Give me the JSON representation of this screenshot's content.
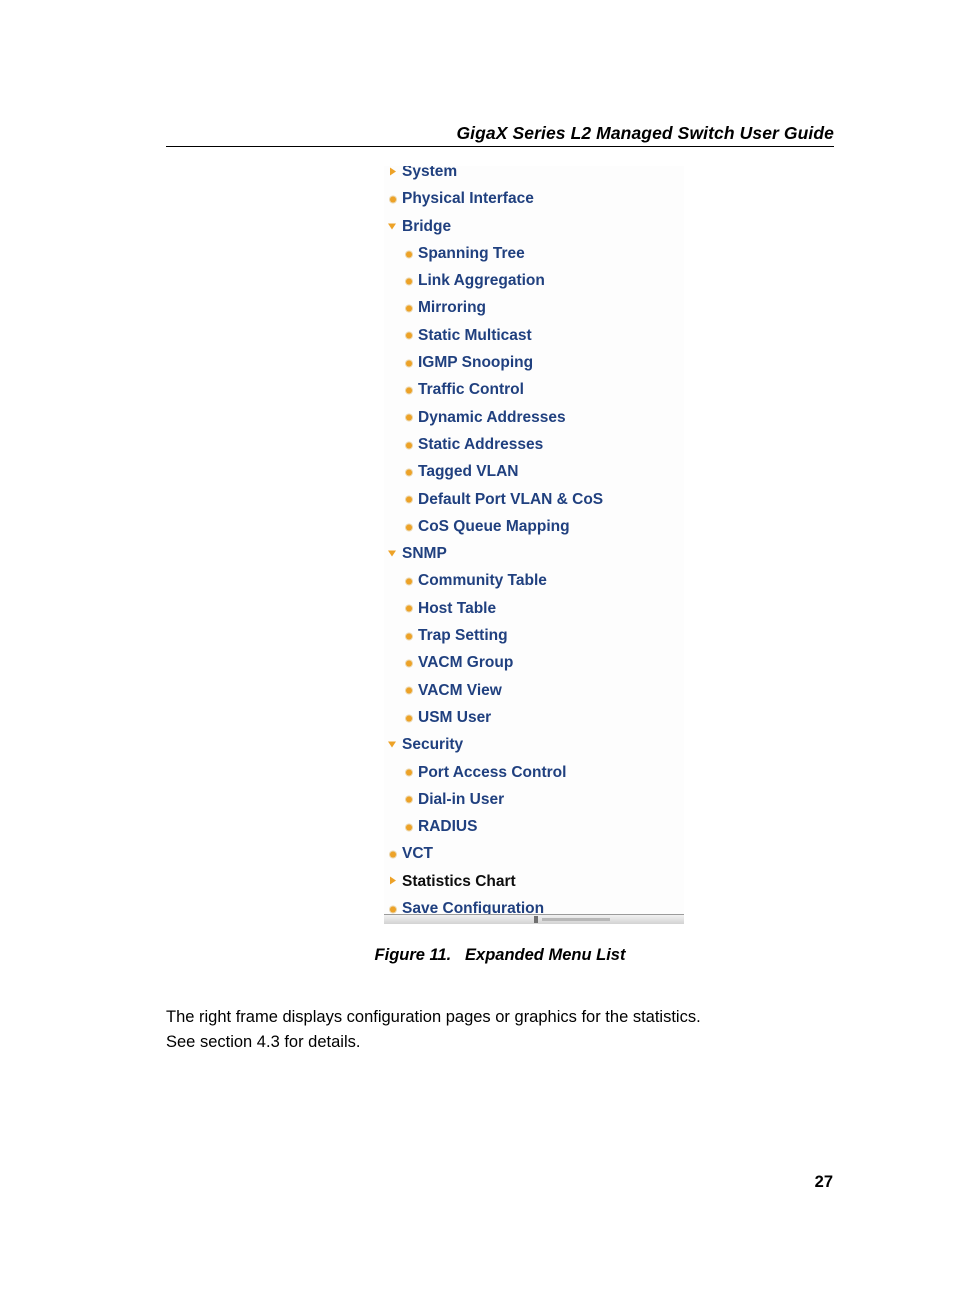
{
  "document": {
    "header_title": "GigaX Series L2 Managed Switch User Guide",
    "page_number": "27"
  },
  "figure": {
    "caption": "Figure 11.   Expanded Menu List",
    "colors": {
      "link_blue": "#20407f",
      "marker_orange": "#eda227",
      "selected_black": "#0d0d0d",
      "background": "#fdfdfd"
    },
    "menu": {
      "items": [
        {
          "label": "System",
          "level": 1,
          "marker": "tri-right",
          "state": "collapsed",
          "selected": false
        },
        {
          "label": "Physical Interface",
          "level": 1,
          "marker": "bullet",
          "state": "leaf",
          "selected": false
        },
        {
          "label": "Bridge",
          "level": 1,
          "marker": "tri-down",
          "state": "expanded",
          "selected": false
        },
        {
          "label": "Spanning Tree",
          "level": 2,
          "marker": "bullet",
          "state": "leaf",
          "selected": false
        },
        {
          "label": "Link Aggregation",
          "level": 2,
          "marker": "bullet",
          "state": "leaf",
          "selected": false
        },
        {
          "label": "Mirroring",
          "level": 2,
          "marker": "bullet",
          "state": "leaf",
          "selected": false
        },
        {
          "label": "Static Multicast",
          "level": 2,
          "marker": "bullet",
          "state": "leaf",
          "selected": false
        },
        {
          "label": "IGMP Snooping",
          "level": 2,
          "marker": "bullet",
          "state": "leaf",
          "selected": false
        },
        {
          "label": "Traffic Control",
          "level": 2,
          "marker": "bullet",
          "state": "leaf",
          "selected": false
        },
        {
          "label": "Dynamic Addresses",
          "level": 2,
          "marker": "bullet",
          "state": "leaf",
          "selected": false
        },
        {
          "label": "Static Addresses",
          "level": 2,
          "marker": "bullet",
          "state": "leaf",
          "selected": false
        },
        {
          "label": "Tagged VLAN",
          "level": 2,
          "marker": "bullet",
          "state": "leaf",
          "selected": false
        },
        {
          "label": "Default Port VLAN & CoS",
          "level": 2,
          "marker": "bullet",
          "state": "leaf",
          "selected": false
        },
        {
          "label": "CoS Queue Mapping",
          "level": 2,
          "marker": "bullet",
          "state": "leaf",
          "selected": false
        },
        {
          "label": "SNMP",
          "level": 1,
          "marker": "tri-down",
          "state": "expanded",
          "selected": false
        },
        {
          "label": "Community Table",
          "level": 2,
          "marker": "bullet",
          "state": "leaf",
          "selected": false
        },
        {
          "label": "Host Table",
          "level": 2,
          "marker": "bullet",
          "state": "leaf",
          "selected": false
        },
        {
          "label": "Trap Setting",
          "level": 2,
          "marker": "bullet",
          "state": "leaf",
          "selected": false
        },
        {
          "label": "VACM Group",
          "level": 2,
          "marker": "bullet",
          "state": "leaf",
          "selected": false
        },
        {
          "label": "VACM View",
          "level": 2,
          "marker": "bullet",
          "state": "leaf",
          "selected": false
        },
        {
          "label": "USM User",
          "level": 2,
          "marker": "bullet",
          "state": "leaf",
          "selected": false
        },
        {
          "label": "Security",
          "level": 1,
          "marker": "tri-down",
          "state": "expanded",
          "selected": false
        },
        {
          "label": "Port Access Control",
          "level": 2,
          "marker": "bullet",
          "state": "leaf",
          "selected": false
        },
        {
          "label": "Dial-in User",
          "level": 2,
          "marker": "bullet",
          "state": "leaf",
          "selected": false
        },
        {
          "label": "RADIUS",
          "level": 2,
          "marker": "bullet",
          "state": "leaf",
          "selected": false
        },
        {
          "label": "VCT",
          "level": 1,
          "marker": "bullet",
          "state": "leaf",
          "selected": false
        },
        {
          "label": "Statistics Chart",
          "level": 1,
          "marker": "tri-right",
          "state": "collapsed",
          "selected": true
        },
        {
          "label": "Save Configuration",
          "level": 1,
          "marker": "bullet",
          "state": "leaf",
          "selected": false
        }
      ]
    }
  },
  "body": {
    "paragraph_lines": [
      "The right frame displays configuration pages or graphics for the statistics.",
      "See section 4.3 for details."
    ]
  }
}
